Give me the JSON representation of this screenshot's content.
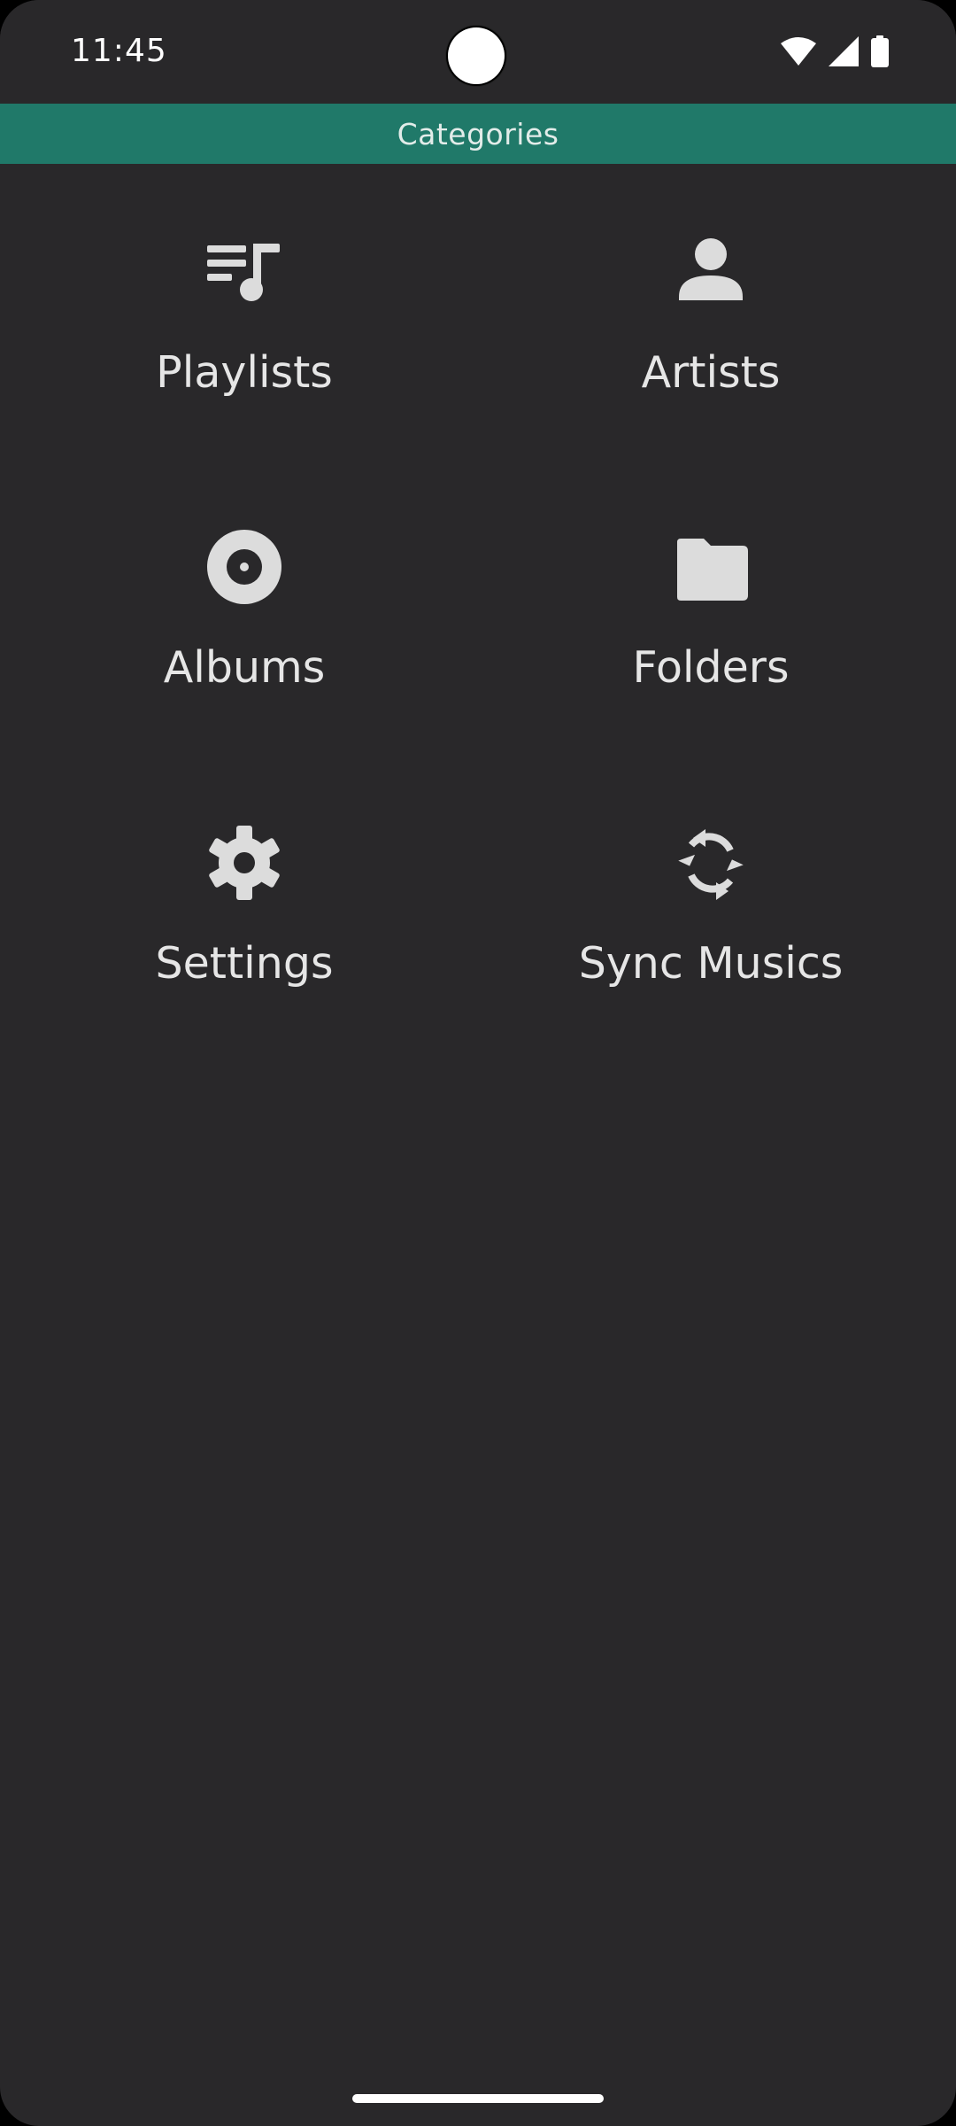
{
  "status_bar": {
    "time": "11:45",
    "icons": [
      "wifi-icon",
      "cellular-signal-icon",
      "battery-icon"
    ]
  },
  "toolbar": {
    "title": "Categories",
    "background_color": "#207969"
  },
  "categories": [
    {
      "label": "Playlists",
      "icon": "playlist-music-icon"
    },
    {
      "label": "Artists",
      "icon": "person-icon"
    },
    {
      "label": "Albums",
      "icon": "album-disc-icon"
    },
    {
      "label": "Folders",
      "icon": "folder-icon"
    },
    {
      "label": "Settings",
      "icon": "gear-icon"
    },
    {
      "label": "Sync Musics",
      "icon": "sync-icon"
    }
  ],
  "colors": {
    "background": "#29282a",
    "accent": "#207969",
    "icon": "#dcdcdc",
    "text": "#e6e6e6"
  }
}
